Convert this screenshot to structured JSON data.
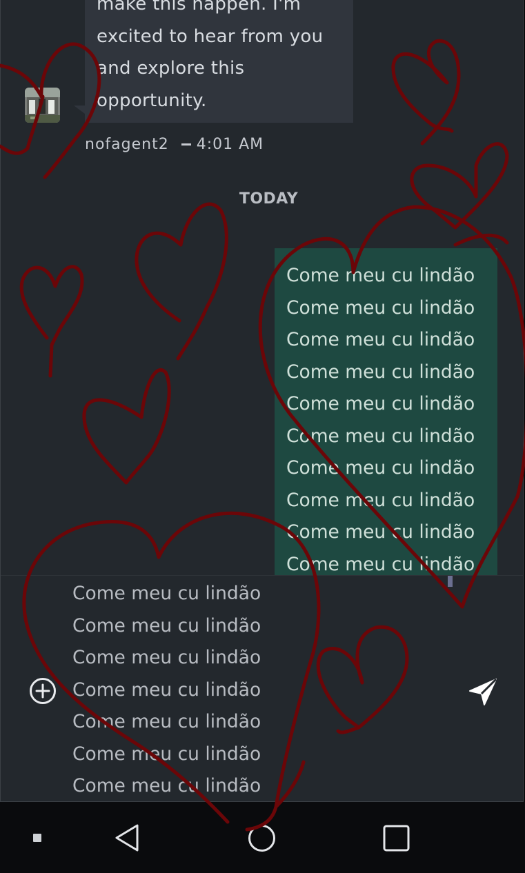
{
  "conversation": {
    "incoming_message": {
      "text": "make this happen. I'm\nexcited to hear from you\nand explore this\nopportunity.",
      "sender": "nofagent2",
      "time": "4:01 AM"
    },
    "day_divider": "TODAY",
    "outgoing_message": {
      "lines": [
        "Come meu cu lindão",
        "Come meu cu lindão",
        "Come meu cu lindão",
        "Come meu cu lindão",
        "Come meu cu lindão",
        "Come meu cu lindão",
        "Come meu cu lindão",
        "Come meu cu lindão",
        "Come meu cu lindão",
        "Come meu cu lindão"
      ]
    }
  },
  "composer": {
    "draft_lines": [
      "Come meu cu lindão",
      "Come meu cu lindão",
      "Come meu cu lindão",
      "Come meu cu lindão",
      "Come meu cu lindão",
      "Come meu cu lindão",
      "Come meu cu lindão"
    ],
    "add_icon": "plus-circle-icon",
    "send_icon": "send-icon"
  },
  "nav_bar": {
    "icons": [
      "recent-dot-icon",
      "back-icon",
      "home-icon",
      "overview-icon"
    ]
  },
  "colors": {
    "panel_background": "#23282d",
    "incoming_bubble": "#30353d",
    "outgoing_bubble": "#1e4941",
    "doodle_ink": "#6b0608"
  }
}
